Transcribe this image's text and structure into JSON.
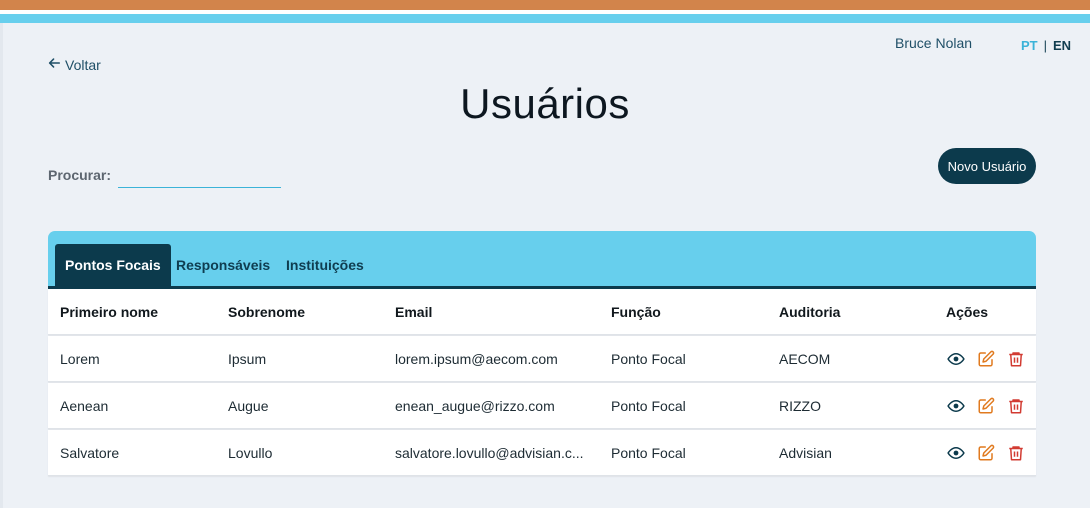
{
  "header": {
    "user_name": "Bruce Nolan",
    "languages": [
      "PT",
      "EN"
    ],
    "language_separator": "|",
    "active_language": "PT",
    "back_label": "Voltar"
  },
  "page": {
    "title": "Usuários",
    "search_label": "Procurar:",
    "search_value": "",
    "new_user_label": "Novo Usuário"
  },
  "tabs": [
    {
      "label": "Pontos Focais",
      "active": true
    },
    {
      "label": "Responsáveis",
      "active": false
    },
    {
      "label": "Instituições",
      "active": false
    }
  ],
  "table": {
    "columns": [
      "Primeiro nome",
      "Sobrenome",
      "Email",
      "Função",
      "Auditoria",
      "Ações"
    ],
    "rows": [
      {
        "first_name": "Lorem",
        "last_name": "Ipsum",
        "email": "lorem.ipsum@aecom.com",
        "role": "Ponto Focal",
        "audit": "AECOM"
      },
      {
        "first_name": "Aenean",
        "last_name": "Augue",
        "email": "enean_augue@rizzo.com",
        "role": "Ponto Focal",
        "audit": "RIZZO"
      },
      {
        "first_name": "Salvatore",
        "last_name": "Lovullo",
        "email": "salvatore.lovullo@advisian.c...",
        "role": "Ponto Focal",
        "audit": "Advisian"
      }
    ],
    "row_actions": [
      "eye-icon",
      "edit-icon",
      "trash-icon"
    ]
  },
  "colors": {
    "accent_orange": "#d2844b",
    "accent_blue": "#67cfed",
    "dark_navy": "#0c3a4c",
    "edit_orange": "#e07a1f",
    "delete_red": "#d23b32"
  }
}
